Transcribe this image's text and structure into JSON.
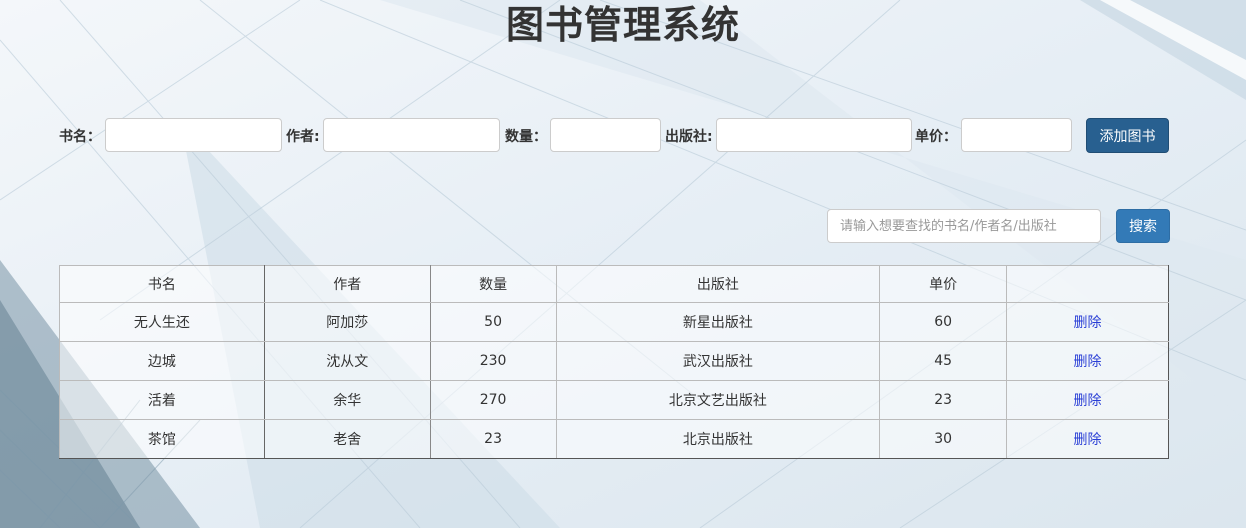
{
  "page": {
    "title": "图书管理系统"
  },
  "add_form": {
    "fields": [
      {
        "label": "书名：",
        "value": ""
      },
      {
        "label": "作者:",
        "value": ""
      },
      {
        "label": "数量：",
        "value": ""
      },
      {
        "label": "出版社:",
        "value": ""
      },
      {
        "label": "单价：",
        "value": ""
      }
    ],
    "submit_label": "添加图书"
  },
  "search": {
    "placeholder": "请输入想要查找的书名/作者名/出版社",
    "button_label": "搜索"
  },
  "table": {
    "columns": [
      "书名",
      "作者",
      "数量",
      "出版社",
      "单价",
      ""
    ],
    "rows": [
      {
        "name": "无人生还",
        "author": "阿加莎",
        "count": "50",
        "publisher": "新星出版社",
        "price": "60",
        "action": "删除"
      },
      {
        "name": "边城",
        "author": "沈从文",
        "count": "230",
        "publisher": "武汉出版社",
        "price": "45",
        "action": "删除"
      },
      {
        "name": "活着",
        "author": "余华",
        "count": "270",
        "publisher": "北京文艺出版社",
        "price": "23",
        "action": "删除"
      },
      {
        "name": "茶馆",
        "author": "老舍",
        "count": "23",
        "publisher": "北京出版社",
        "price": "30",
        "action": "删除"
      }
    ]
  }
}
